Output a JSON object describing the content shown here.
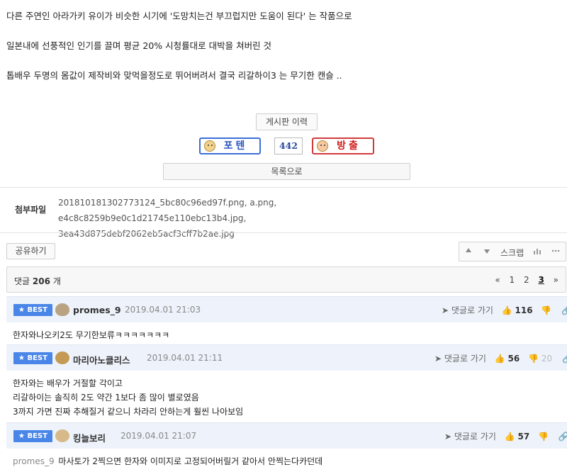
{
  "article": {
    "lines": [
      "다른 주연인 아라가키 유이가 비슷한 시기에  '도망치는건 부끄럽지만 도움이 된다' 는 작품으로",
      "일본내에 선풍적인 인기를 끌며 평균 20% 시청률대로 대박을 쳐버린 것",
      "톱배우 두명의 몸값이 제작비와 맞먹을정도로 뛰어버려서 결국 리갈하이3 는 무기한 캔슬 .."
    ]
  },
  "buttons": {
    "history": "게시판 이력",
    "potent": "포텐",
    "vote_count": "442",
    "expel": "방출",
    "list": "목록으로",
    "share": "공유하기"
  },
  "attachments": {
    "label": "첨부파일",
    "files": "201810181302773124_5bc80c96ed97f.png,   a.png,   e4c8c8259b9e0c1d21745e110ebc13b4.jpg,",
    "files2": "3ea43d875debf2062eb5acf3cff7b2ae.jpg"
  },
  "toolbar": {
    "up_icon": "arrow-up-icon",
    "down_icon": "arrow-down-icon",
    "scrap": "스크랩",
    "chart_icon": "chart-icon",
    "more_icon": "ellipsis-icon"
  },
  "comments_header": {
    "label": "댓글",
    "count": "206",
    "unit": "개",
    "pages": [
      "«",
      "1",
      "2",
      "3",
      "»"
    ],
    "current_page": "3"
  },
  "comments": [
    {
      "badge": "★ BEST",
      "nick": "promes_9",
      "date": "2019.04.01 21:03",
      "goto": "댓글로 가기",
      "likes": "116",
      "dislikes": "",
      "body": [
        "한자와나오키2도 무기한보류ㅋㅋㅋㅋㅋㅋㅋ"
      ]
    },
    {
      "badge": "★ BEST",
      "nick": "마리아노클리스",
      "date": "2019.04.01 21:11",
      "goto": "댓글로 가기",
      "likes": "56",
      "dislikes": "20",
      "body": [
        "한자와는 배우가 거절할 각이고",
        "리갈하이는 솔직히 2도 약간 1보다 좀 많이 별로였음",
        "3까지 가면 진짜 추해질거 같으니 차라리 안하는게 훨씬 나아보임"
      ]
    },
    {
      "badge": "★ BEST",
      "nick": "킹늘보리",
      "date": "2019.04.01 21:07",
      "goto": "댓글로 가기",
      "likes": "57",
      "dislikes": "",
      "mention": "promes_9",
      "body": [
        "마사토가 2찍으면 한자와 이미지로 고정되어버릴거 같아서 안찍는다카던데"
      ]
    }
  ],
  "colors": {
    "accent": "#4a86e8",
    "best_bg": "#eef3fb",
    "vote_up": "#3b6fd6",
    "vote_down": "#d23a3a"
  }
}
